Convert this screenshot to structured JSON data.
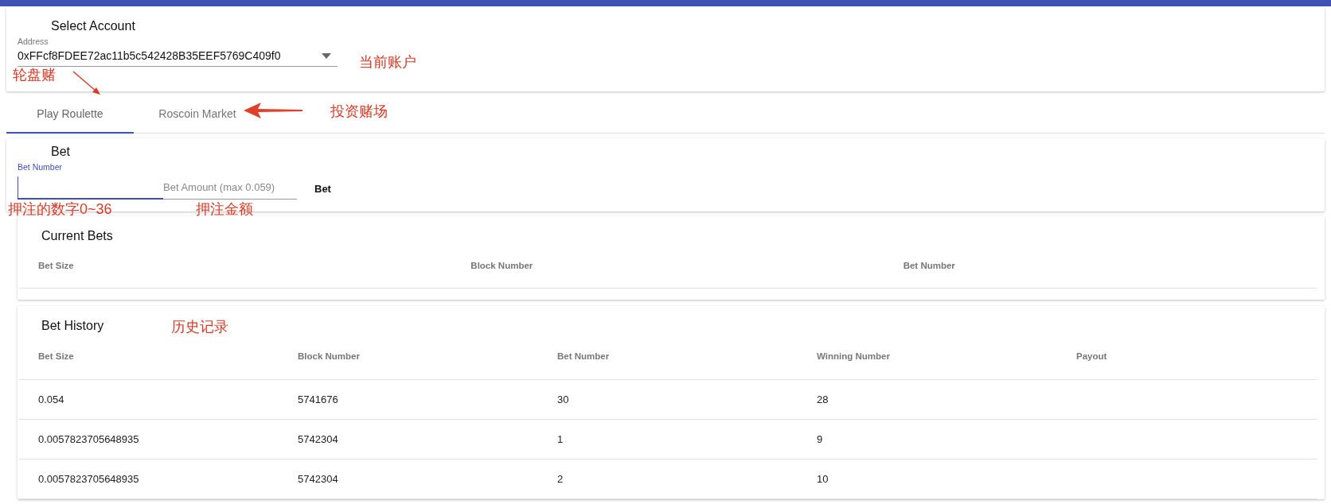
{
  "account": {
    "title": "Select Account",
    "field_label": "Address",
    "value": "0xFFcf8FDEE72ac11b5c542428B35EEF5769C409f0"
  },
  "tabs": [
    {
      "label": "Play Roulette",
      "selected": true
    },
    {
      "label": "Roscoin Market",
      "selected": false
    }
  ],
  "bet": {
    "title": "Bet",
    "number_field": {
      "label": "Bet Number"
    },
    "amount_field": {
      "placeholder": "Bet Amount (max 0.059)"
    },
    "button": "Bet"
  },
  "current_bets": {
    "title": "Current Bets",
    "columns": [
      "Bet Size",
      "Block Number",
      "Bet Number"
    ]
  },
  "bet_history": {
    "title": "Bet History",
    "columns": [
      "Bet Size",
      "Block Number",
      "Bet Number",
      "Winning Number",
      "Payout"
    ],
    "rows": [
      [
        "0.054",
        "5741676",
        "30",
        "28",
        ""
      ],
      [
        "0.0057823705648935",
        "5742304",
        "1",
        "9",
        ""
      ],
      [
        "0.0057823705648935",
        "5742304",
        "2",
        "10",
        ""
      ]
    ]
  },
  "annotations": [
    {
      "kind": "note",
      "text": "轮盘赌"
    },
    {
      "kind": "note",
      "text": "当前账户"
    },
    {
      "kind": "note",
      "text": "投资赌场"
    },
    {
      "kind": "note",
      "text": "押注的数字0~36"
    },
    {
      "kind": "note",
      "text": "押注金额"
    },
    {
      "kind": "note",
      "text": "历史记录"
    }
  ]
}
